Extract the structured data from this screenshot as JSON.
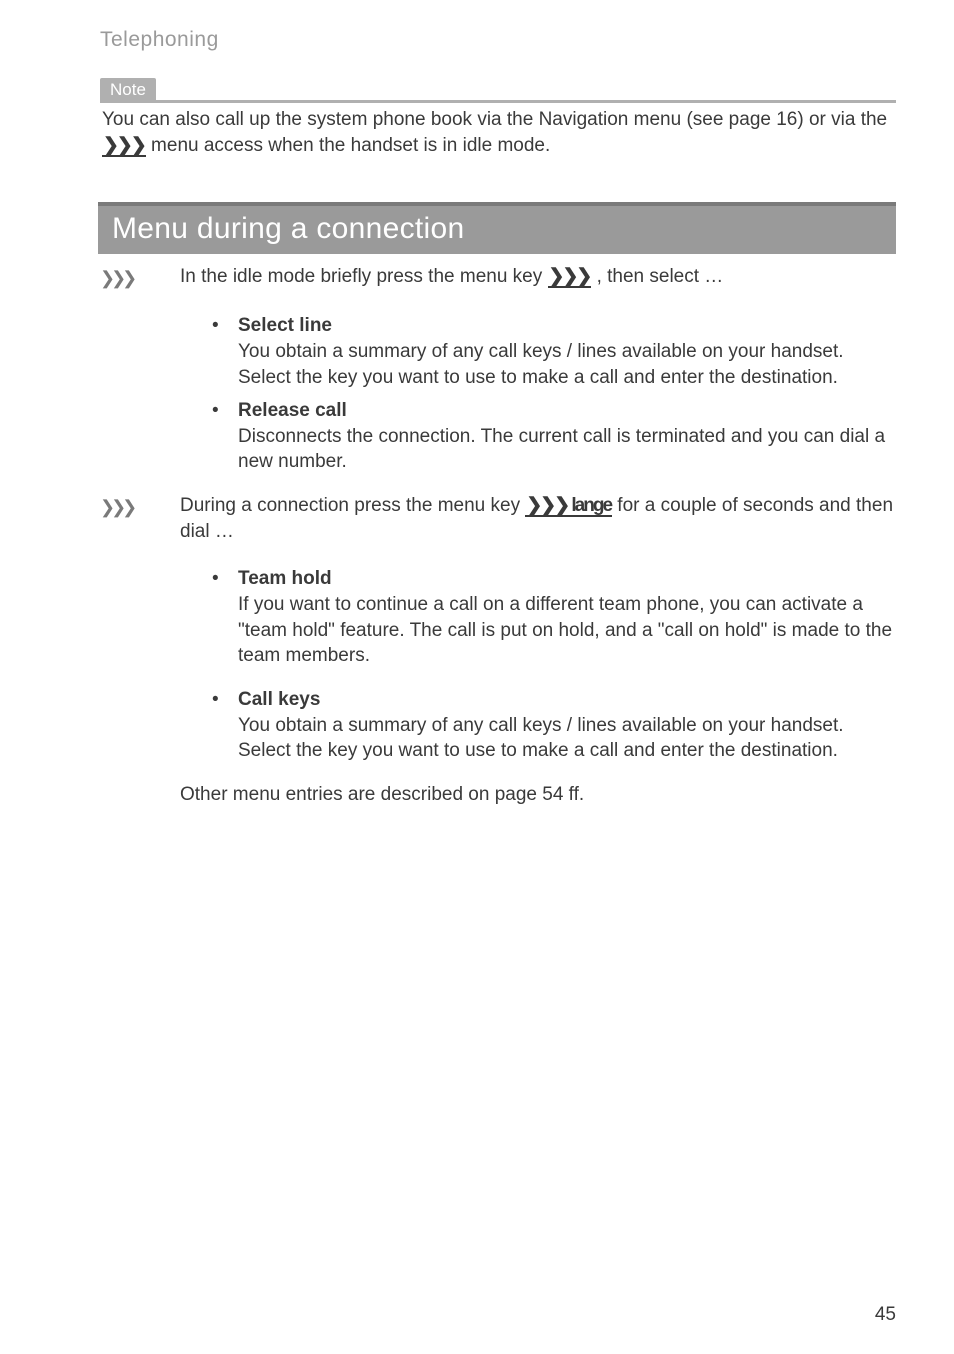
{
  "header": {
    "running_head": "Telephoning"
  },
  "note": {
    "label": "Note",
    "body_pre": "You can also call up the system phone book via the Navigation menu (see  page 16) or via the ",
    "menu_glyph": "❯❯❯",
    "body_post": " menu access when the handset is in idle mode."
  },
  "section": {
    "title": "Menu during a connection",
    "step1_icon": "❯❯❯",
    "step1_pre": "In the idle mode briefly press the menu key ",
    "step1_key": "❯❯❯",
    "step1_post": " , then select …",
    "bullets1": [
      {
        "title": "Select line",
        "body": "You obtain a summary of any call keys / lines available on your handset. Select the key you want to use to make a call and enter the destination."
      },
      {
        "title": "Release call",
        "body": "Disconnects the connection. The current call is terminated and you can dial a new number."
      }
    ],
    "step2_icon": "❯❯❯",
    "step2_pre": "During a connection press the menu key ",
    "step2_key": "❯❯❯",
    "step2_bold": " lange",
    "step2_post": " for a couple of seconds and then dial …",
    "bullets2": [
      {
        "title": "Team hold",
        "body": "If you want to continue a call on a different team phone, you can activate a \"team hold\" feature. The call is put on hold, and a \"call on hold\" is made to the team members."
      },
      {
        "title": "Call keys",
        "body": "You obtain a summary of any call keys / lines available on your handset. Select the key you want to use to make a call and enter the destination."
      }
    ],
    "closing": "Other menu entries are described on page 54 ff."
  },
  "page_number": "45"
}
